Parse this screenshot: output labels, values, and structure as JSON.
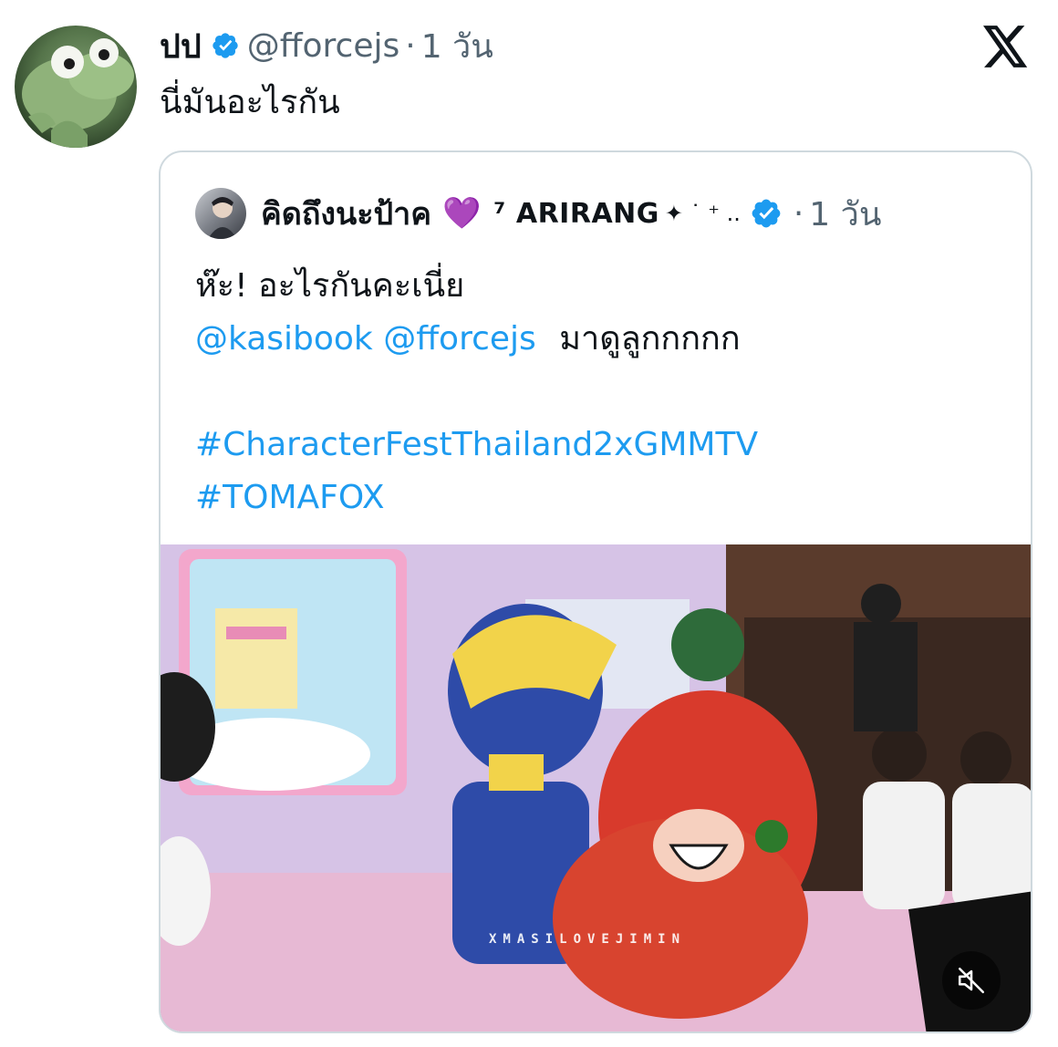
{
  "tweet": {
    "display_name": "ปป",
    "handle": "@fforcejs",
    "separator": "·",
    "time": "1 วัน",
    "text": "นี่มันอะไรกัน",
    "verified_icon": "verified-badge-icon",
    "brand_icon": "x-logo-icon"
  },
  "quote": {
    "display_name": "คิดถึงนะป้าค",
    "heart_emoji": "💜",
    "name_suffix": "⁷ ARIRANG",
    "sparkles": "✦ ˙ ⁺ ..",
    "separator": "·",
    "time": "1 วัน",
    "line1": "ห๊ะ! อะไรกันคะเนี่ย",
    "mentions": [
      "@kasibook",
      "@fforcejs"
    ],
    "mention_tail": "มาดูลูกกกกก",
    "hashtags": [
      "#CharacterFestThailand2xGMMTV",
      "#TOMAFOX"
    ],
    "video": {
      "watermark": "XMASILOVEJIMIN",
      "mute_icon": "speaker-muted-icon"
    }
  },
  "colors": {
    "link": "#1d9bf0",
    "secondary_text": "#536471",
    "verified": "#1d9bf0",
    "border": "#cfd9de",
    "heart": "#8b3ed6"
  }
}
